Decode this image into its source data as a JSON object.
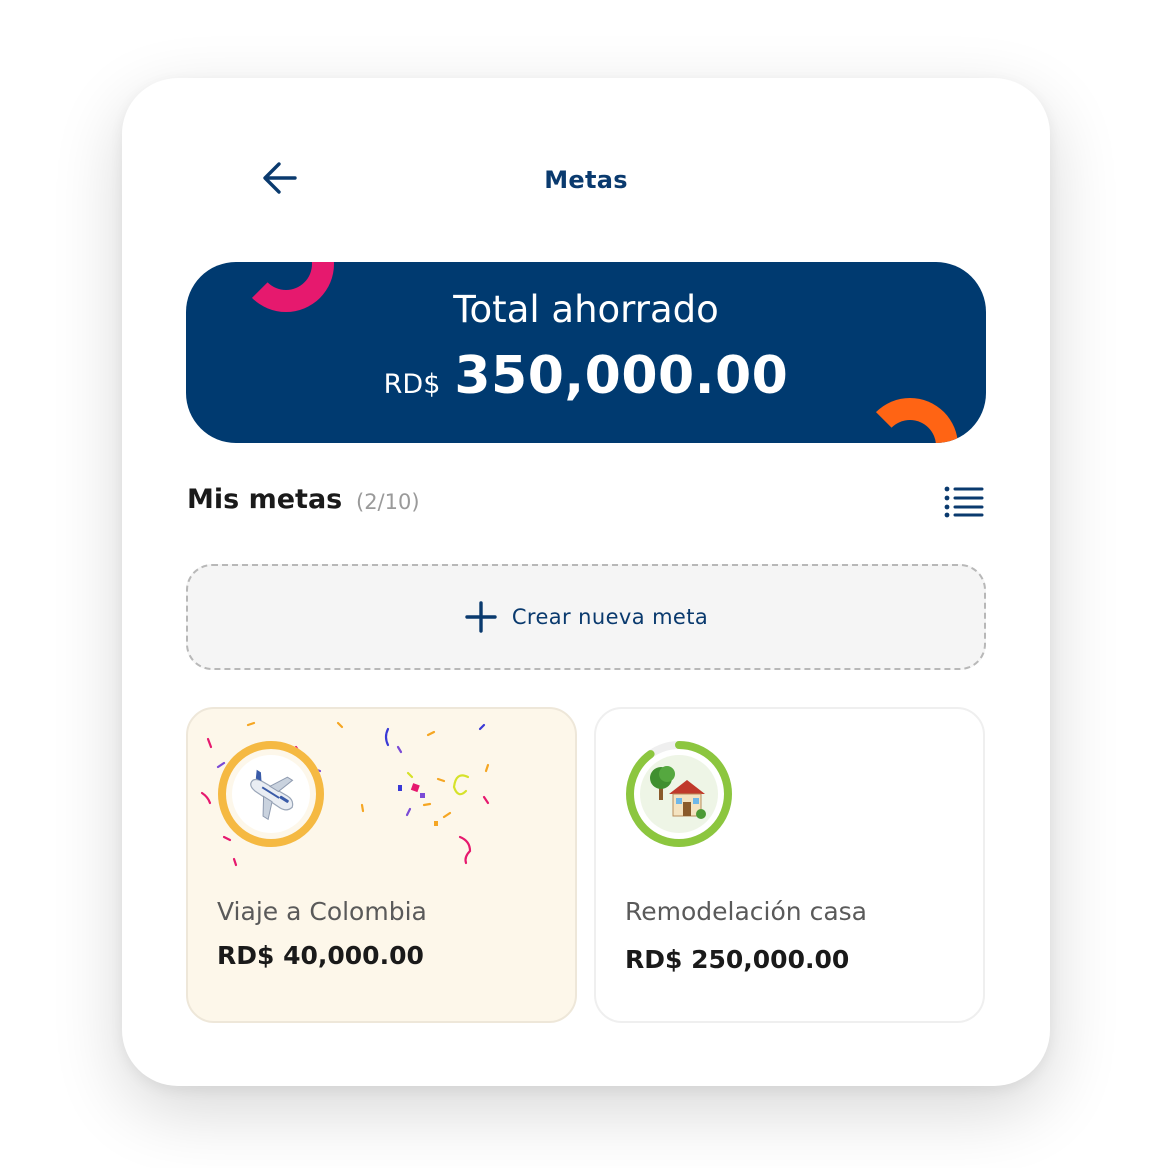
{
  "header": {
    "title": "Metas"
  },
  "banner": {
    "label": "Total ahorrado",
    "currency": "RD$",
    "amount": "350,000.00"
  },
  "section": {
    "title": "Mis metas",
    "count": "(2/10)"
  },
  "create_goal": {
    "label": "Crear nueva meta"
  },
  "goals": [
    {
      "name": "Viaje a Colombia",
      "amount": "RD$ 40,000.00",
      "icon": "airplane-icon",
      "progress": 1.0,
      "ring_color": "#f5b942",
      "completed": true
    },
    {
      "name": "Remodelación casa",
      "amount": "RD$ 250,000.00",
      "icon": "house-icon",
      "progress": 0.9,
      "ring_color": "#8cc63f",
      "completed": false
    }
  ],
  "colors": {
    "primary": "#003a70",
    "accent_pink": "#e6196e",
    "accent_orange": "#ff6414"
  }
}
